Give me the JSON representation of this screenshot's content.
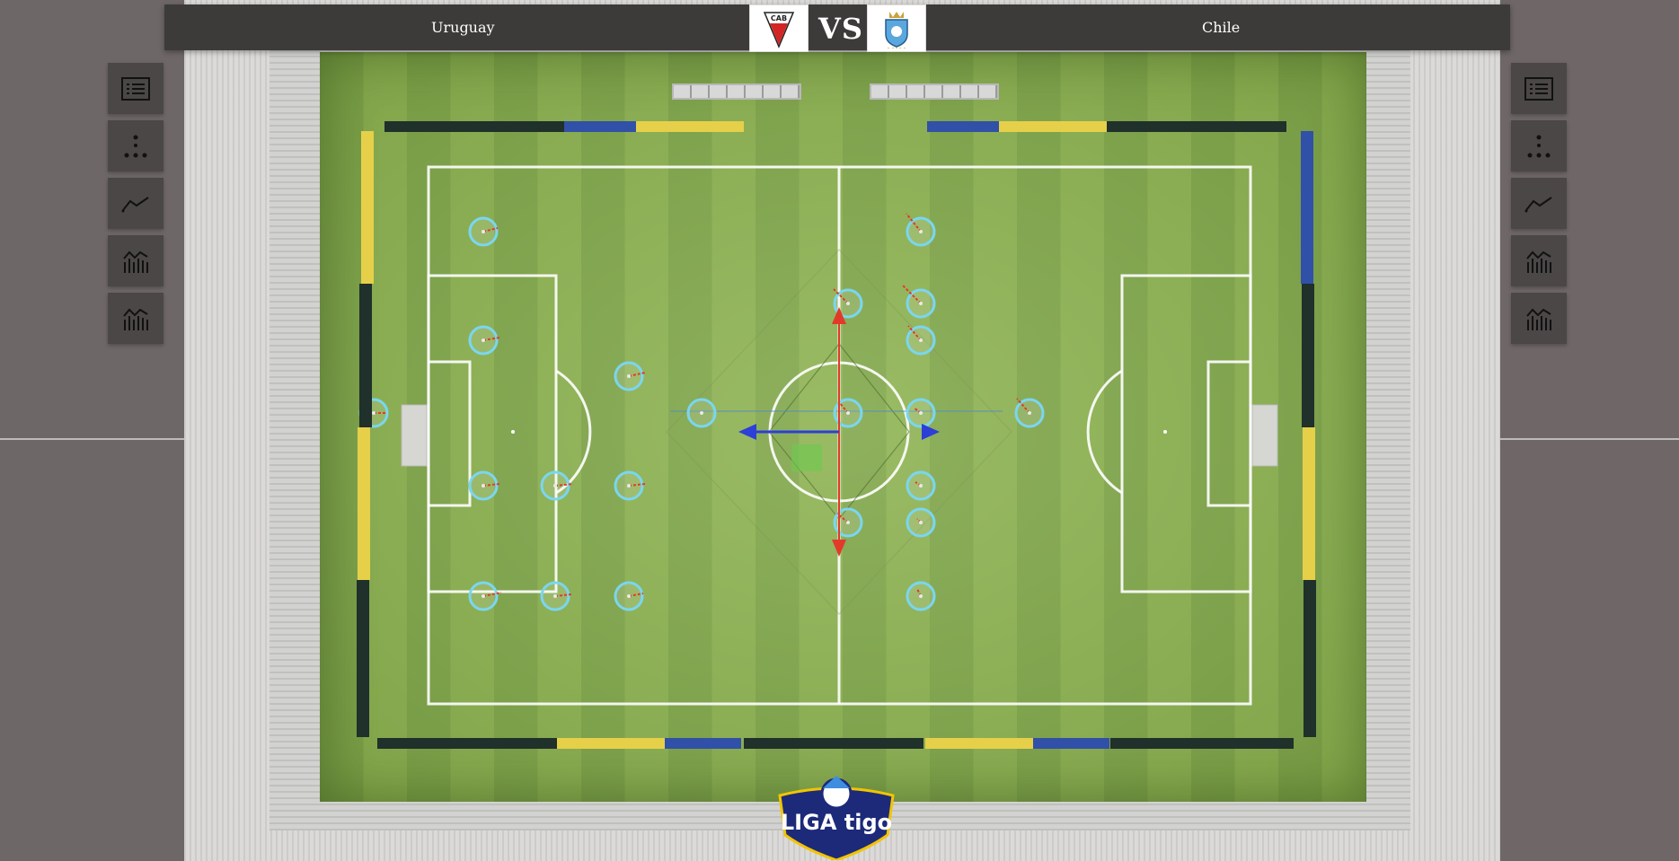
{
  "match": {
    "home_team": "Uruguay",
    "away_team": "Chile",
    "vs_label": "VS",
    "home_crest_text": "CAB"
  },
  "colors": {
    "pitch_light": "#8cb24f",
    "pitch_dark": "#7fa648",
    "player_ring": "#7ad6f0",
    "direction_line": "#e23a2a",
    "gizmo_red": "#e23a2a",
    "gizmo_blue": "#2c3fd6",
    "topbar": "#3c3b39",
    "side_button": "#4a4746"
  },
  "left_menu": [
    {
      "icon": "list-icon",
      "name": "lineup"
    },
    {
      "icon": "formation-icon",
      "name": "formation"
    },
    {
      "icon": "line-chart-icon",
      "name": "trend"
    },
    {
      "icon": "bar-chart-icon",
      "name": "stats-1"
    },
    {
      "icon": "bar-chart-icon",
      "name": "stats-2"
    }
  ],
  "right_menu": [
    {
      "icon": "list-icon",
      "name": "lineup"
    },
    {
      "icon": "formation-icon",
      "name": "formation"
    },
    {
      "icon": "line-chart-icon",
      "name": "trend"
    },
    {
      "icon": "bar-chart-icon",
      "name": "stats-1"
    },
    {
      "icon": "bar-chart-icon",
      "name": "stats-2"
    }
  ],
  "logo": {
    "text": "LIGA tigo"
  }
}
